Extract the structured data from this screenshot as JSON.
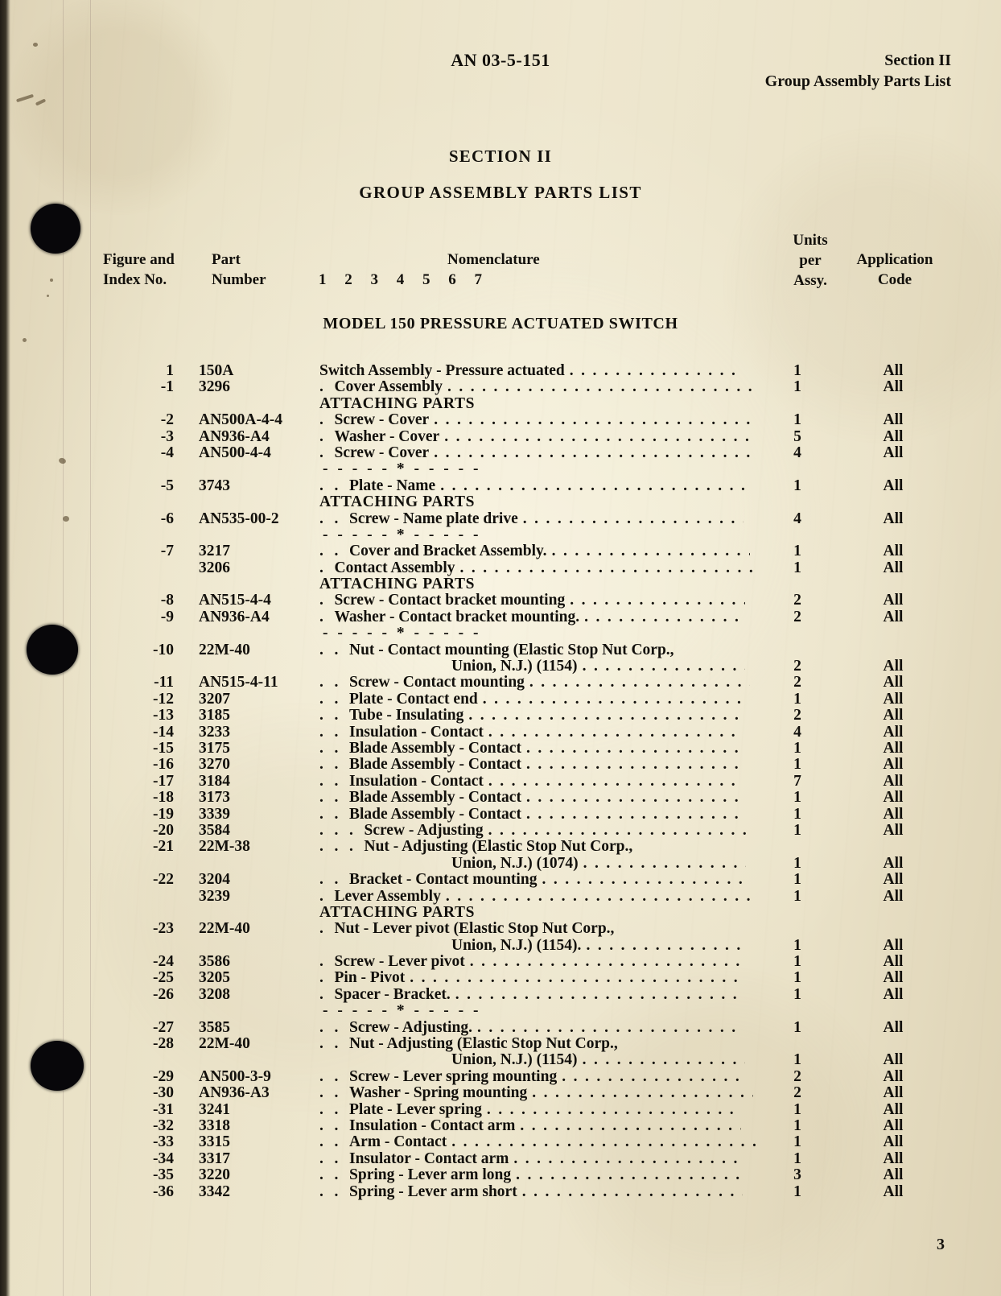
{
  "header": {
    "document_number": "AN 03-5-151",
    "section": "Section II",
    "subtitle": "Group Assembly Parts List"
  },
  "titles": {
    "section_title": "SECTION II",
    "section_subtitle": "GROUP ASSEMBLY PARTS LIST",
    "model_title": "MODEL 150 PRESSURE ACTUATED SWITCH"
  },
  "column_headers": {
    "figure_line1": "Figure and",
    "figure_line2": "Index No.",
    "part_line1": "Part",
    "part_line2": "Number",
    "nomenclature": "Nomenclature",
    "nomenclature_levels": "1 2 3 4 5 6 7",
    "units_line1": "Units",
    "units_line2": "per",
    "units_line3": "Assy.",
    "application_line1": "Application",
    "application_line2": "Code"
  },
  "separator_text": "- - - - - * - - - - -",
  "attaching_parts_label": "ATTACHING PARTS",
  "page_number": "3",
  "rows": [
    {
      "kind": "item",
      "index": "1",
      "part": "150A",
      "level": 0,
      "nomenclature": "Switch Assembly - Pressure actuated",
      "units": "1",
      "app": "All"
    },
    {
      "kind": "item",
      "index": "-1",
      "part": "3296",
      "level": 1,
      "nomenclature": "Cover Assembly",
      "units": "1",
      "app": "All"
    },
    {
      "kind": "attaching"
    },
    {
      "kind": "item",
      "index": "-2",
      "part": "AN500A-4-4",
      "level": 1,
      "nomenclature": "Screw - Cover",
      "units": "1",
      "app": "All"
    },
    {
      "kind": "item",
      "index": "-3",
      "part": "AN936-A4",
      "level": 1,
      "nomenclature": "Washer - Cover",
      "units": "5",
      "app": "All"
    },
    {
      "kind": "item",
      "index": "-4",
      "part": "AN500-4-4",
      "level": 1,
      "nomenclature": "Screw - Cover",
      "units": "4",
      "app": "All"
    },
    {
      "kind": "separator"
    },
    {
      "kind": "item",
      "index": "-5",
      "part": "3743",
      "level": 2,
      "nomenclature": "Plate - Name",
      "units": "1",
      "app": "All"
    },
    {
      "kind": "attaching"
    },
    {
      "kind": "item",
      "index": "-6",
      "part": "AN535-00-2",
      "level": 2,
      "nomenclature": "Screw - Name plate drive",
      "units": "4",
      "app": "All"
    },
    {
      "kind": "separator"
    },
    {
      "kind": "item",
      "index": "-7",
      "part": "3217",
      "level": 2,
      "nomenclature": "Cover and Bracket Assembly.",
      "units": "1",
      "app": "All"
    },
    {
      "kind": "item",
      "index": "",
      "part": "3206",
      "level": 1,
      "nomenclature": "Contact Assembly",
      "units": "1",
      "app": "All"
    },
    {
      "kind": "attaching"
    },
    {
      "kind": "item",
      "index": "-8",
      "part": "AN515-4-4",
      "level": 1,
      "nomenclature": "Screw - Contact bracket mounting",
      "units": "2",
      "app": "All"
    },
    {
      "kind": "item",
      "index": "-9",
      "part": "AN936-A4",
      "level": 1,
      "nomenclature": "Washer - Contact bracket mounting.",
      "units": "2",
      "app": "All"
    },
    {
      "kind": "separator"
    },
    {
      "kind": "item2",
      "index": "-10",
      "part": "22M-40",
      "level": 2,
      "nomenclature": "Nut - Contact mounting (Elastic Stop Nut Corp.,",
      "continuation": "Union, N.J.) (1154)",
      "units": "2",
      "app": "All"
    },
    {
      "kind": "item",
      "index": "-11",
      "part": "AN515-4-11",
      "level": 2,
      "nomenclature": "Screw - Contact mounting",
      "units": "2",
      "app": "All"
    },
    {
      "kind": "item",
      "index": "-12",
      "part": "3207",
      "level": 2,
      "nomenclature": "Plate - Contact end",
      "units": "1",
      "app": "All"
    },
    {
      "kind": "item",
      "index": "-13",
      "part": "3185",
      "level": 2,
      "nomenclature": "Tube - Insulating",
      "units": "2",
      "app": "All"
    },
    {
      "kind": "item",
      "index": "-14",
      "part": "3233",
      "level": 2,
      "nomenclature": "Insulation - Contact",
      "units": "4",
      "app": "All"
    },
    {
      "kind": "item",
      "index": "-15",
      "part": "3175",
      "level": 2,
      "nomenclature": "Blade Assembly - Contact",
      "units": "1",
      "app": "All"
    },
    {
      "kind": "item",
      "index": "-16",
      "part": "3270",
      "level": 2,
      "nomenclature": "Blade Assembly - Contact",
      "units": "1",
      "app": "All"
    },
    {
      "kind": "item",
      "index": "-17",
      "part": "3184",
      "level": 2,
      "nomenclature": "Insulation - Contact",
      "units": "7",
      "app": "All"
    },
    {
      "kind": "item",
      "index": "-18",
      "part": "3173",
      "level": 2,
      "nomenclature": "Blade Assembly - Contact",
      "units": "1",
      "app": "All"
    },
    {
      "kind": "item",
      "index": "-19",
      "part": "3339",
      "level": 2,
      "nomenclature": "Blade Assembly - Contact",
      "units": "1",
      "app": "All"
    },
    {
      "kind": "item",
      "index": "-20",
      "part": "3584",
      "level": 3,
      "nomenclature": "Screw - Adjusting",
      "units": "1",
      "app": "All"
    },
    {
      "kind": "item2",
      "index": "-21",
      "part": "22M-38",
      "level": 3,
      "nomenclature": "Nut - Adjusting (Elastic Stop Nut Corp.,",
      "continuation": "Union, N.J.) (1074)",
      "units": "1",
      "app": "All"
    },
    {
      "kind": "item",
      "index": "-22",
      "part": "3204",
      "level": 2,
      "nomenclature": "Bracket - Contact mounting",
      "units": "1",
      "app": "All"
    },
    {
      "kind": "item",
      "index": "",
      "part": "3239",
      "level": 1,
      "nomenclature": "Lever Assembly",
      "units": "1",
      "app": "All"
    },
    {
      "kind": "attaching"
    },
    {
      "kind": "item2",
      "index": "-23",
      "part": "22M-40",
      "level": 1,
      "nomenclature": "Nut - Lever pivot (Elastic Stop Nut Corp.,",
      "continuation": "Union, N.J.) (1154).",
      "units": "1",
      "app": "All"
    },
    {
      "kind": "item",
      "index": "-24",
      "part": "3586",
      "level": 1,
      "nomenclature": "Screw - Lever pivot",
      "units": "1",
      "app": "All"
    },
    {
      "kind": "item",
      "index": "-25",
      "part": "3205",
      "level": 1,
      "nomenclature": "Pin - Pivot",
      "units": "1",
      "app": "All"
    },
    {
      "kind": "item",
      "index": "-26",
      "part": "3208",
      "level": 1,
      "nomenclature": "Spacer - Bracket.",
      "units": "1",
      "app": "All"
    },
    {
      "kind": "separator"
    },
    {
      "kind": "item",
      "index": "-27",
      "part": "3585",
      "level": 2,
      "nomenclature": "Screw - Adjusting.",
      "units": "1",
      "app": "All"
    },
    {
      "kind": "item2",
      "index": "-28",
      "part": "22M-40",
      "level": 2,
      "nomenclature": "Nut - Adjusting (Elastic Stop Nut Corp.,",
      "continuation": "Union, N.J.) (1154)",
      "units": "1",
      "app": "All"
    },
    {
      "kind": "item",
      "index": "-29",
      "part": "AN500-3-9",
      "level": 2,
      "nomenclature": "Screw - Lever spring mounting",
      "units": "2",
      "app": "All"
    },
    {
      "kind": "item",
      "index": "-30",
      "part": "AN936-A3",
      "level": 2,
      "nomenclature": "Washer - Spring mounting",
      "units": "2",
      "app": "All"
    },
    {
      "kind": "item",
      "index": "-31",
      "part": "3241",
      "level": 2,
      "nomenclature": "Plate - Lever spring",
      "units": "1",
      "app": "All"
    },
    {
      "kind": "item",
      "index": "-32",
      "part": "3318",
      "level": 2,
      "nomenclature": "Insulation - Contact arm",
      "units": "1",
      "app": "All"
    },
    {
      "kind": "item",
      "index": "-33",
      "part": "3315",
      "level": 2,
      "nomenclature": "Arm - Contact",
      "units": "1",
      "app": "All"
    },
    {
      "kind": "item",
      "index": "-34",
      "part": "3317",
      "level": 2,
      "nomenclature": "Insulator - Contact arm",
      "units": "1",
      "app": "All"
    },
    {
      "kind": "item",
      "index": "-35",
      "part": "3220",
      "level": 2,
      "nomenclature": "Spring - Lever arm long",
      "units": "3",
      "app": "All"
    },
    {
      "kind": "item",
      "index": "-36",
      "part": "3342",
      "level": 2,
      "nomenclature": "Spring - Lever arm short",
      "units": "1",
      "app": "All"
    }
  ]
}
